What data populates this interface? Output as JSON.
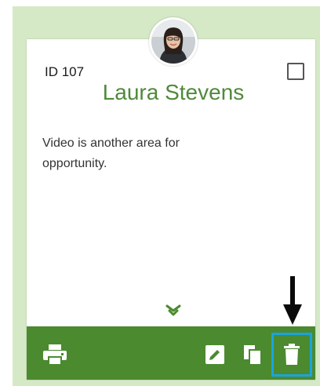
{
  "card": {
    "id_label": "ID 107",
    "name": "Laura Stevens",
    "body": "Video is another area for opportunity."
  },
  "icons": {
    "avatar": "user-photo",
    "expand": "double-chevron-down-icon",
    "print": "printer-icon",
    "edit": "pencil-icon",
    "copy": "copy-icon",
    "delete": "trash-icon",
    "annotation": "arrow-down-icon"
  },
  "colors": {
    "background": "#d5e9c6",
    "accent": "#4b8a2f",
    "name_text": "#4f8a3a",
    "highlight": "#1aa3e0"
  }
}
